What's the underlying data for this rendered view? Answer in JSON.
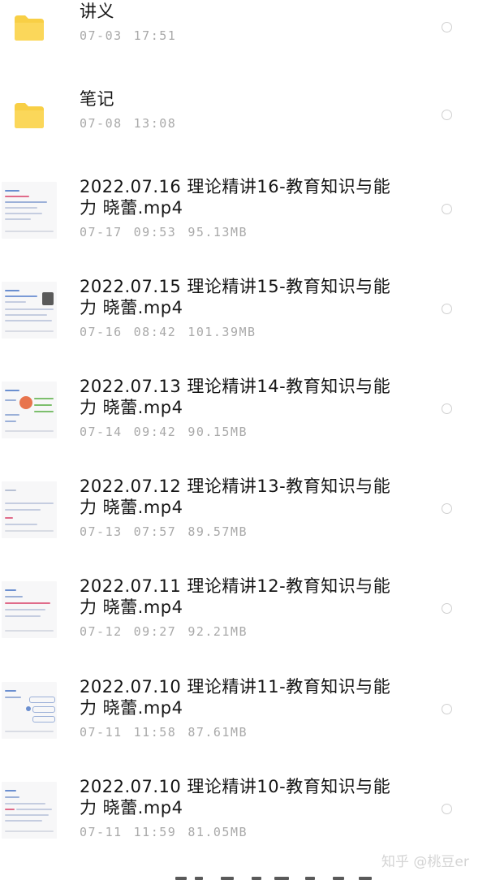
{
  "files": [
    {
      "type": "folder",
      "name": "讲义",
      "date": "07-03",
      "time": "17:51",
      "size": ""
    },
    {
      "type": "folder",
      "name": "笔记",
      "date": "07-08",
      "time": "13:08",
      "size": ""
    },
    {
      "type": "video",
      "name": "2022.07.16 理论精讲16-教育知识与能力 晓蕾.mp4",
      "date": "07-17",
      "time": "09:53",
      "size": "95.13MB"
    },
    {
      "type": "video",
      "name": "2022.07.15 理论精讲15-教育知识与能力 晓蕾.mp4",
      "date": "07-16",
      "time": "08:42",
      "size": "101.39MB"
    },
    {
      "type": "video",
      "name": "2022.07.13 理论精讲14-教育知识与能力 晓蕾.mp4",
      "date": "07-14",
      "time": "09:42",
      "size": "90.15MB"
    },
    {
      "type": "video",
      "name": "2022.07.12 理论精讲13-教育知识与能力 晓蕾.mp4",
      "date": "07-13",
      "time": "07:57",
      "size": "89.57MB"
    },
    {
      "type": "video",
      "name": "2022.07.11 理论精讲12-教育知识与能力 晓蕾.mp4",
      "date": "07-12",
      "time": "09:27",
      "size": "92.21MB"
    },
    {
      "type": "video",
      "name": "2022.07.10 理论精讲11-教育知识与能力 晓蕾.mp4",
      "date": "07-11",
      "time": "11:58",
      "size": "87.61MB"
    },
    {
      "type": "video",
      "name": "2022.07.10 理论精讲10-教育知识与能力 晓蕾.mp4",
      "date": "07-11",
      "time": "11:59",
      "size": "81.05MB"
    }
  ],
  "watermark": "知乎 @桃豆er",
  "colors": {
    "folder": "#f8cf45",
    "title": "#151515",
    "meta": "#a9a9a9",
    "radio": "#cfcfcf"
  }
}
